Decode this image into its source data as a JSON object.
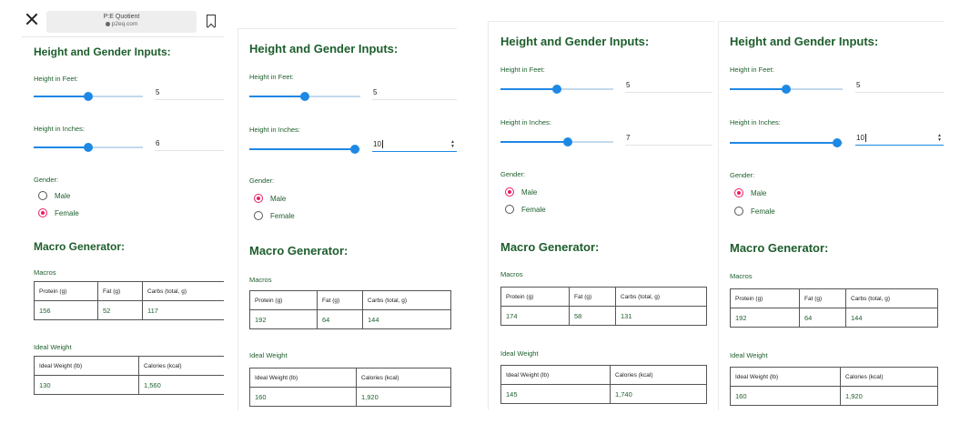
{
  "browser": {
    "title": "P:E Quotient",
    "domain": "p2eq.com"
  },
  "labels": {
    "section_inputs": "Height and Gender Inputs:",
    "height_feet": "Height in Feet:",
    "height_inches": "Height in Inches:",
    "gender": "Gender:",
    "male": "Male",
    "female": "Female",
    "section_macro": "Macro Generator:",
    "macros": "Macros",
    "ideal_weight": "Ideal Weight",
    "protein": "Protein (g)",
    "fat": "Fat (g)",
    "carbs": "Carbs (total, g)",
    "ideal_weight_lb": "Ideal Weight (lb)",
    "calories": "Calories (kcal)"
  },
  "panels": [
    {
      "feet": "5",
      "inches": "6",
      "feet_level": 0.5,
      "inches_level": 0.5,
      "gender": "Female",
      "protein": "156",
      "fat": "52",
      "carbs": "117",
      "ideal_weight": "130",
      "calories": "1,560"
    },
    {
      "feet": "5",
      "inches": "10",
      "feet_level": 0.5,
      "inches_level": 0.95,
      "gender": "Male",
      "protein": "192",
      "fat": "64",
      "carbs": "144",
      "ideal_weight": "160",
      "calories": "1,920"
    },
    {
      "feet": "5",
      "inches": "7",
      "feet_level": 0.5,
      "inches_level": 0.6,
      "gender": "Male",
      "protein": "174",
      "fat": "58",
      "carbs": "131",
      "ideal_weight": "145",
      "calories": "1,740"
    },
    {
      "feet": "5",
      "inches": "10",
      "feet_level": 0.5,
      "inches_level": 0.95,
      "gender": "Male",
      "protein": "192",
      "fat": "64",
      "carbs": "144",
      "ideal_weight": "160",
      "calories": "1,920"
    }
  ],
  "colors": {
    "heading_green": "#1d5e2c",
    "slider_blue": "#1e88e5",
    "radio_pink": "#e91e63"
  },
  "icons": [
    "close-icon",
    "lock-icon",
    "bookmark-icon"
  ]
}
